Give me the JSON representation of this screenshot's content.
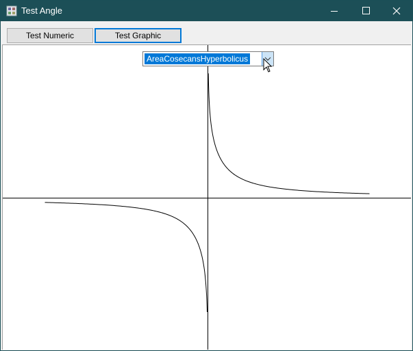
{
  "window": {
    "title": "Test Angle",
    "controls": {
      "minimize_icon": "minimize-icon",
      "maximize_icon": "maximize-icon",
      "close_icon": "close-icon"
    }
  },
  "tabs": [
    {
      "label": "Test Numeric",
      "active": false
    },
    {
      "label": "Test Graphic",
      "active": true
    }
  ],
  "function_select": {
    "selected": "AreaCosecansHyperbolicus",
    "icon": "chevron-down-icon"
  },
  "graph": {
    "function": "arcsch",
    "axes_color": "#000000",
    "curve_color": "#000000",
    "background": "#ffffff"
  },
  "colors": {
    "titlebar": "#1c4f57",
    "accent": "#0078d7",
    "selection": "#0078d7"
  }
}
